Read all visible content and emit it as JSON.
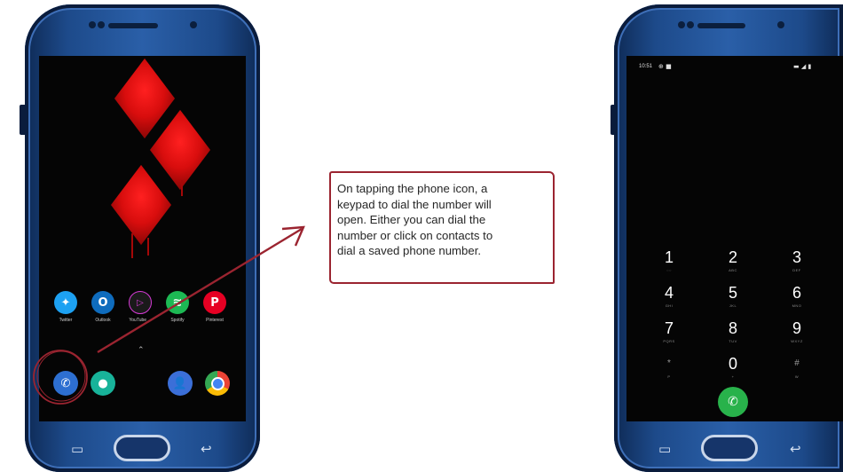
{
  "annotation": {
    "line1": "On tapping the phone icon, a",
    "line2": "keypad to dial the number will",
    "line3": "open. Either you can dial the",
    "line4": "number or click on contacts to",
    "line5": "dial a saved phone number."
  },
  "home_screen": {
    "apps": [
      {
        "label": "Twitter",
        "icon": "twitter-icon",
        "color": "#1da1f2"
      },
      {
        "label": "Outlook",
        "icon": "outlook-icon",
        "color": "#0f6cbd"
      },
      {
        "label": "YouTube ...",
        "icon": "youtube-music-icon",
        "color": "#1a1a1a"
      },
      {
        "label": "Spotify",
        "icon": "spotify-icon",
        "color": "#1db954"
      },
      {
        "label": "Pinterest",
        "icon": "pinterest-icon",
        "color": "#e60023"
      }
    ],
    "dock": [
      {
        "icon": "phone-icon",
        "color": "#2d6fd1"
      },
      {
        "icon": "messages-icon",
        "color": "#18b39a"
      },
      {
        "icon": "contacts-icon",
        "color": "#3b6fd8"
      },
      {
        "icon": "chrome-icon",
        "color": "#ffffff"
      }
    ],
    "highlight_color": "#9b2430",
    "wallpaper_color": "#e01010"
  },
  "dialer": {
    "status_time": "10:51",
    "keys": [
      {
        "digit": "1",
        "letters": "◌◌"
      },
      {
        "digit": "2",
        "letters": "ABC"
      },
      {
        "digit": "3",
        "letters": "DEF"
      },
      {
        "digit": "4",
        "letters": "GHI"
      },
      {
        "digit": "5",
        "letters": "JKL"
      },
      {
        "digit": "6",
        "letters": "MNO"
      },
      {
        "digit": "7",
        "letters": "PQRS"
      },
      {
        "digit": "8",
        "letters": "TUV"
      },
      {
        "digit": "9",
        "letters": "WXYZ"
      },
      {
        "digit": "*",
        "letters": "P"
      },
      {
        "digit": "0",
        "letters": "+"
      },
      {
        "digit": "#",
        "letters": "W"
      }
    ],
    "call_color": "#28b24b"
  }
}
